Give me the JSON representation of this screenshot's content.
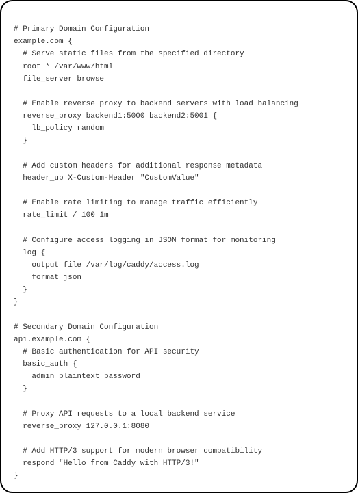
{
  "code": {
    "lines": [
      "# Primary Domain Configuration",
      "example.com {",
      "  # Serve static files from the specified directory",
      "  root * /var/www/html",
      "  file_server browse",
      "",
      "  # Enable reverse proxy to backend servers with load balancing",
      "  reverse_proxy backend1:5000 backend2:5001 {",
      "    lb_policy random",
      "  }",
      "",
      "  # Add custom headers for additional response metadata",
      "  header_up X-Custom-Header \"CustomValue\"",
      "",
      "  # Enable rate limiting to manage traffic efficiently",
      "  rate_limit / 100 1m",
      "",
      "  # Configure access logging in JSON format for monitoring",
      "  log {",
      "    output file /var/log/caddy/access.log",
      "    format json",
      "  }",
      "}",
      "",
      "# Secondary Domain Configuration",
      "api.example.com {",
      "  # Basic authentication for API security",
      "  basic_auth {",
      "    admin plaintext password",
      "  }",
      "",
      "  # Proxy API requests to a local backend service",
      "  reverse_proxy 127.0.0.1:8080",
      "",
      "  # Add HTTP/3 support for modern browser compatibility",
      "  respond \"Hello from Caddy with HTTP/3!\"",
      "}"
    ]
  }
}
